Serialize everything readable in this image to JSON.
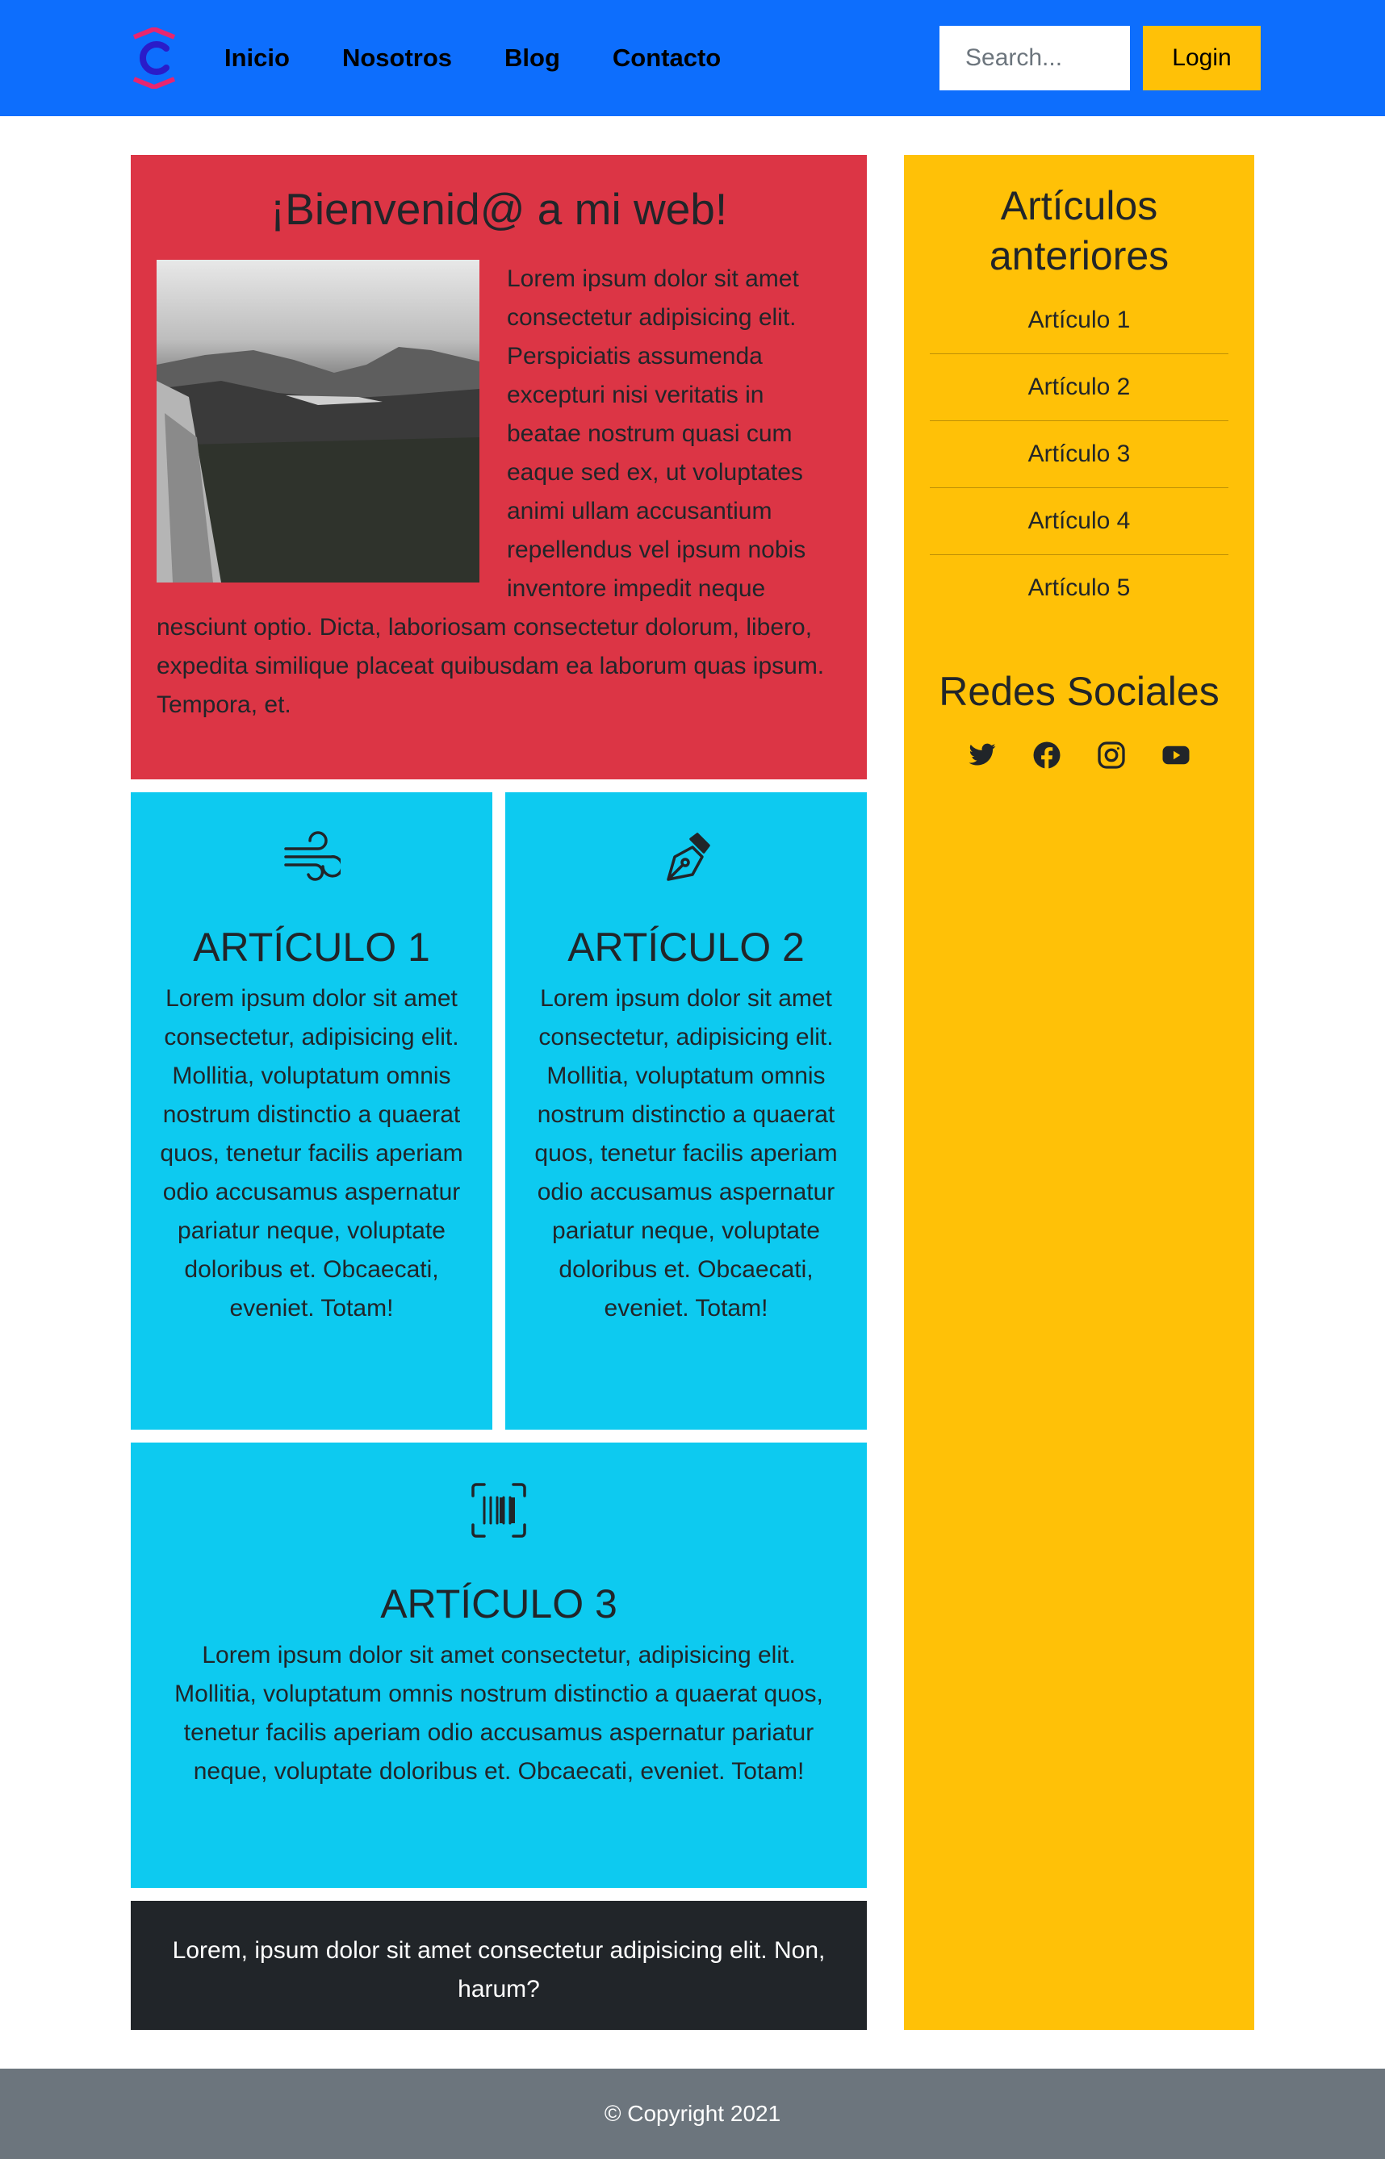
{
  "nav": {
    "brand_icon": "c-logo-icon",
    "links": [
      "Inicio",
      "Nosotros",
      "Blog",
      "Contacto"
    ],
    "search_placeholder": "Search...",
    "login_label": "Login",
    "colors": {
      "navbar": "#0d6efd",
      "login": "#ffc107"
    }
  },
  "welcome": {
    "title": "¡Bienvenid@ a mi web!",
    "image_icon": "landscape-photo",
    "text": "Lorem ipsum dolor sit amet consectetur adipisicing elit. Perspiciatis assumenda excepturi nisi veritatis in beatae nostrum quasi cum eaque sed ex, ut voluptates animi ullam accusantium repellendus vel ipsum nobis inventore impedit neque nesciunt optio. Dicta, laboriosam consectetur dolorum, libero, expedita similique placeat quibusdam ea laborum quas ipsum. Tempora, et.",
    "color": "#dc3545"
  },
  "articles": [
    {
      "title": "ARTÍCULO 1",
      "icon": "wind-icon",
      "text": "Lorem ipsum dolor sit amet consectetur, adipisicing elit. Mollitia, voluptatum omnis nostrum distinctio a quaerat quos, tenetur facilis aperiam odio accusamus aspernatur pariatur neque, voluptate doloribus et. Obcaecati, eveniet. Totam!"
    },
    {
      "title": "ARTÍCULO 2",
      "icon": "pen-nib-icon",
      "text": "Lorem ipsum dolor sit amet consectetur, adipisicing elit. Mollitia, voluptatum omnis nostrum distinctio a quaerat quos, tenetur facilis aperiam odio accusamus aspernatur pariatur neque, voluptate doloribus et. Obcaecati, eveniet. Totam!"
    },
    {
      "title": "ARTÍCULO 3",
      "icon": "barcode-scan-icon",
      "text": "Lorem ipsum dolor sit amet consectetur, adipisicing elit. Mollitia, voluptatum omnis nostrum distinctio a quaerat quos, tenetur facilis aperiam odio accusamus aspernatur pariatur neque, voluptate doloribus et. Obcaecati, eveniet. Totam!"
    }
  ],
  "article_color": "#0dcaf0",
  "dark_box": {
    "text": "Lorem, ipsum dolor sit amet consectetur adipisicing elit. Non, harum?",
    "color": "#212529"
  },
  "sidebar": {
    "title": "Artículos anteriores",
    "items": [
      "Artículo 1",
      "Artículo 2",
      "Artículo 3",
      "Artículo 4",
      "Artículo 5"
    ],
    "social_title": "Redes Sociales",
    "social_icons": [
      "twitter-icon",
      "facebook-icon",
      "instagram-icon",
      "youtube-icon"
    ],
    "color": "#ffc107"
  },
  "footer": {
    "text": "© Copyright 2021",
    "color": "#6c757d"
  }
}
